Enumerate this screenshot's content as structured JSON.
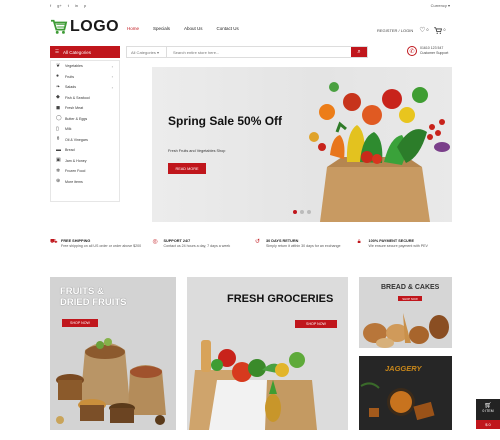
{
  "topbar": {
    "social": [
      "f",
      "g+",
      "t",
      "in",
      "p"
    ],
    "currency": "Currency"
  },
  "logo": {
    "text": "LOGO"
  },
  "nav": {
    "items": [
      "Home",
      "Specials",
      "About Us",
      "Contact Us"
    ],
    "active_index": 0
  },
  "header": {
    "account": "REGISTER / LOGIN",
    "wishlist_count": "0",
    "cart_count": "0"
  },
  "categories": {
    "title": "All Categories",
    "items": [
      {
        "label": "Vegetables",
        "icon": "carrot-icon",
        "has_sub": true
      },
      {
        "label": "Fruits",
        "icon": "apple-icon",
        "has_sub": true
      },
      {
        "label": "Salads",
        "icon": "leaf-icon",
        "has_sub": true
      },
      {
        "label": "Fish & Seafood",
        "icon": "fish-icon",
        "has_sub": false
      },
      {
        "label": "Fresh Meat",
        "icon": "meat-icon",
        "has_sub": false
      },
      {
        "label": "Butter & Eggs",
        "icon": "egg-icon",
        "has_sub": false
      },
      {
        "label": "Milk",
        "icon": "milk-icon",
        "has_sub": false
      },
      {
        "label": "Oil & Vinegars",
        "icon": "bottle-icon",
        "has_sub": false
      },
      {
        "label": "Bread",
        "icon": "bread-icon",
        "has_sub": false
      },
      {
        "label": "Jam & Honey",
        "icon": "jar-icon",
        "has_sub": false
      },
      {
        "label": "Frozen Food",
        "icon": "snowflake-icon",
        "has_sub": false
      },
      {
        "label": "More items",
        "icon": "plus-icon",
        "has_sub": false
      }
    ]
  },
  "search": {
    "category": "All Categories",
    "placeholder": "Search entire store here..."
  },
  "support": {
    "phone": "01610 123 547",
    "label": "Customer Support"
  },
  "hero": {
    "title": "Spring Sale 50% Off",
    "subtitle": "Fresh Fruits and Vegetables Shop",
    "button": "READ MORE",
    "slides": 3,
    "active_slide": 0
  },
  "features": [
    {
      "icon": "truck-icon",
      "title": "FREE SHIPPING",
      "desc": "Free shipping on all US order or order above $200"
    },
    {
      "icon": "headset-icon",
      "title": "SUPPORT 24/7",
      "desc": "Contact us 24 hours a day, 7 days a week"
    },
    {
      "icon": "return-icon",
      "title": "30 DAYS RETURN",
      "desc": "Simply return it within 30 days for an exchange"
    },
    {
      "icon": "lock-icon",
      "title": "100% PAYMENT SECURE",
      "desc": "We ensure secure payment with PEV"
    }
  ],
  "banners": {
    "fruits": {
      "title_line1": "FRUITS &",
      "title_line2": "DRIED FRUITS",
      "button": "SHOP NOW"
    },
    "groceries": {
      "title": "FRESH GROCERIES",
      "button": "SHOP NOW"
    },
    "bread": {
      "title": "BREAD & CAKES",
      "button": "SHOP NOW"
    },
    "jaggery": {
      "title": "JAGGERY"
    }
  },
  "cart_widget": {
    "label": "0 ITEM",
    "amount": "$ 0"
  }
}
